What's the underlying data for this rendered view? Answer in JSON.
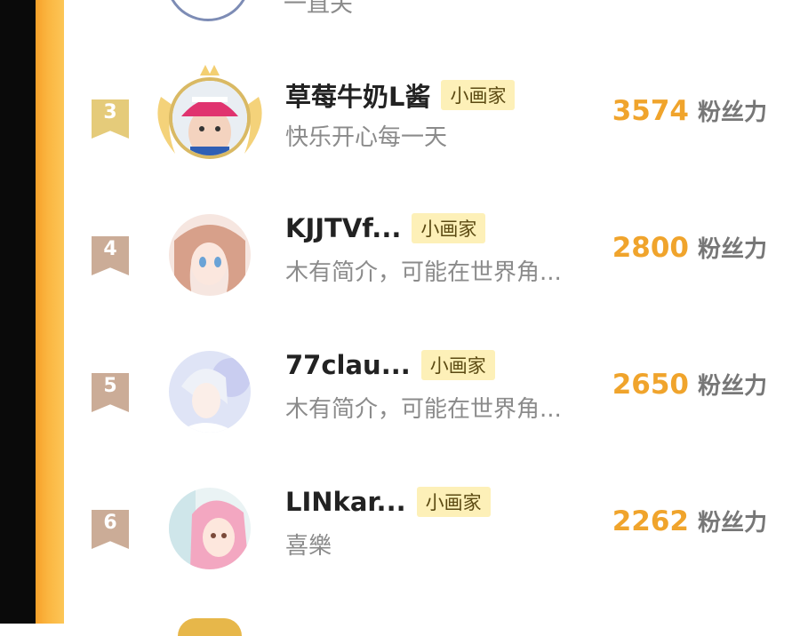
{
  "partial_top": {
    "bio": "一直关"
  },
  "rows": [
    {
      "rank": "3",
      "name": "草莓牛奶L酱",
      "tag": "小画家",
      "bio": "快乐开心每一天",
      "score": "3574",
      "unit": "粉丝力",
      "rank_color": "#e5cb7a",
      "avatar_icon": "avatar-baby-pink-hat"
    },
    {
      "rank": "4",
      "name": "KJJTVf...",
      "tag": "小画家",
      "bio": "木有简介，可能在世界角...",
      "score": "2800",
      "unit": "粉丝力",
      "rank_color": "#cbac97",
      "avatar_icon": "avatar-anime-girl"
    },
    {
      "rank": "5",
      "name": "77clau...",
      "tag": "小画家",
      "bio": "木有简介，可能在世界角...",
      "score": "2650",
      "unit": "粉丝力",
      "rank_color": "#cbac97",
      "avatar_icon": "avatar-anime-boy"
    },
    {
      "rank": "6",
      "name": "LINkar...",
      "tag": "小画家",
      "bio": "喜樂",
      "score": "2262",
      "unit": "粉丝力",
      "rank_color": "#cbac97",
      "avatar_icon": "avatar-pink-hair-girl"
    }
  ],
  "colors": {
    "accent_orange": "#f0a42c",
    "tag_bg": "#fdf0b8",
    "stripe": "#fbb641"
  }
}
